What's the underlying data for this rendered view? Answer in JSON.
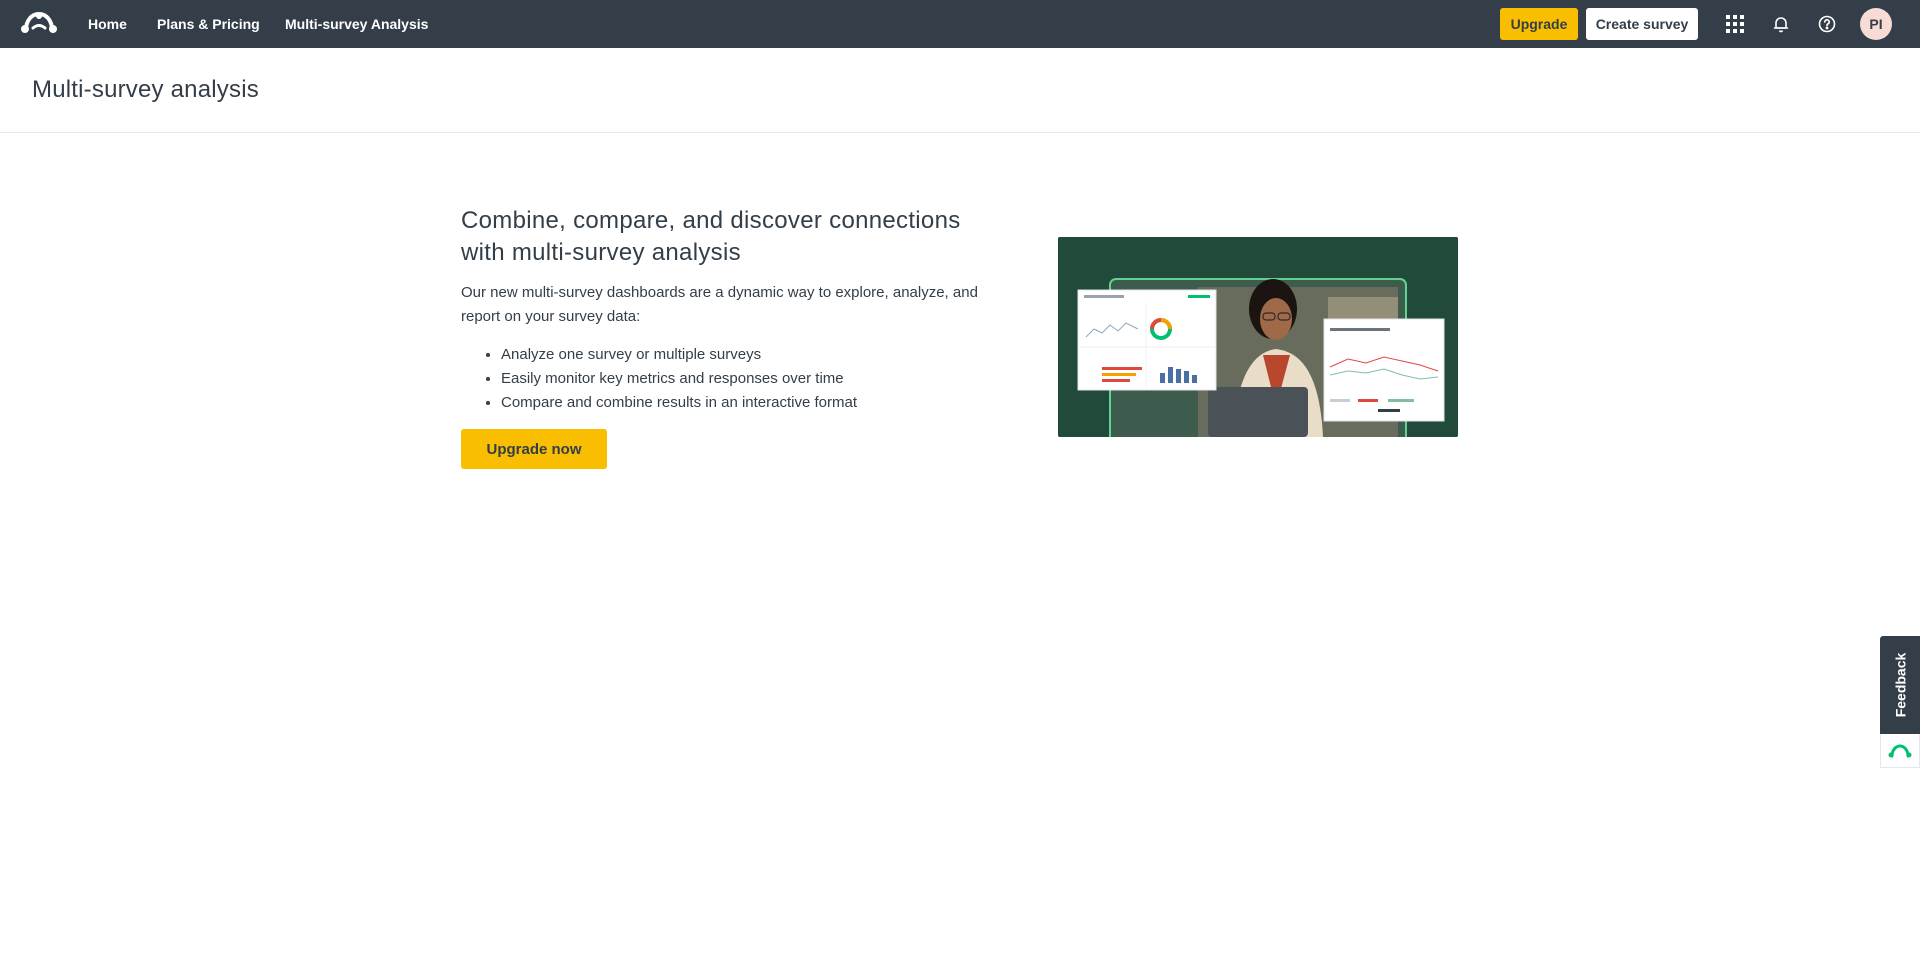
{
  "nav": {
    "home": "Home",
    "plans": "Plans & Pricing",
    "msa": "Multi-survey Analysis",
    "upgrade": "Upgrade",
    "create_survey": "Create survey",
    "avatar_initials": "PI"
  },
  "page": {
    "title": "Multi-survey analysis"
  },
  "promo": {
    "headline": "Combine, compare, and discover connections with multi-survey analysis",
    "description": "Our new multi-survey dashboards are a dynamic way to explore, analyze, and report on your survey data:",
    "bullets": [
      "Analyze one survey or multiple surveys",
      "Easily monitor key metrics and responses over time",
      "Compare and combine results in an interactive format"
    ],
    "cta": "Upgrade now"
  },
  "feedback": {
    "label": "Feedback"
  },
  "colors": {
    "nav_bg": "#333e48",
    "accent_yellow": "#f9be00",
    "hero_bg": "#224a3b",
    "brand_green": "#00bf6f"
  },
  "icons": [
    "surveymonkey-logo-icon",
    "apps-grid-icon",
    "bell-icon",
    "help-icon",
    "feedback-logo-icon"
  ]
}
